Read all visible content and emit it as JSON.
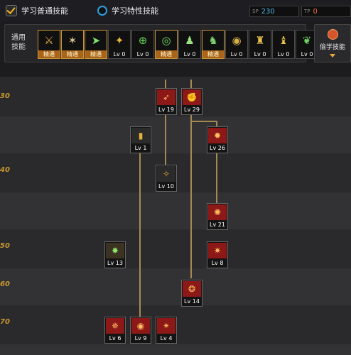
{
  "tabs": [
    {
      "label": "学习普通技能",
      "selected": true
    },
    {
      "label": "学习特性技能",
      "selected": false
    }
  ],
  "stats": [
    {
      "tag": "SP",
      "value": "230",
      "color": "#4fb8e8"
    },
    {
      "tag": "TP",
      "value": "0",
      "color": "#f06a3a"
    }
  ],
  "common_skills": {
    "label": "通用技能",
    "slots": [
      {
        "icon": "stance-icon",
        "glyph": "⚔",
        "color": "#e6b345",
        "level": "精通",
        "learned": true
      },
      {
        "icon": "leap-icon",
        "glyph": "✶",
        "color": "#d9c38a",
        "level": "精通",
        "learned": true
      },
      {
        "icon": "dash-icon",
        "glyph": "➤",
        "color": "#7ee36b",
        "level": "精通",
        "learned": true
      },
      {
        "icon": "wings-icon",
        "glyph": "✦",
        "color": "#e8b33a",
        "level": "Lv 0",
        "learned": false
      },
      {
        "icon": "crosshair-icon",
        "glyph": "⊕",
        "color": "#67d85a",
        "level": "Lv 0",
        "learned": false
      },
      {
        "icon": "target-icon",
        "glyph": "◎",
        "color": "#76de68",
        "level": "精通",
        "learned": true
      },
      {
        "icon": "fighter-icon",
        "glyph": "♟",
        "color": "#9ae07e",
        "level": "Lv 0",
        "learned": false
      },
      {
        "icon": "kick-icon",
        "glyph": "♞",
        "color": "#7bd36b",
        "level": "精通",
        "learned": true
      },
      {
        "icon": "shield-icon",
        "glyph": "◉",
        "color": "#d7b048",
        "level": "Lv 0",
        "learned": false
      },
      {
        "icon": "warrior-icon",
        "glyph": "♜",
        "color": "#e8c04c",
        "level": "Lv 0",
        "learned": false
      },
      {
        "icon": "power-icon",
        "glyph": "♝",
        "color": "#e8c54a",
        "level": "Lv 0",
        "learned": false
      },
      {
        "icon": "vine-icon",
        "glyph": "❦",
        "color": "#6fd35f",
        "level": "Lv 0",
        "learned": false
      }
    ]
  },
  "steal_skill": {
    "label": "偷学技能"
  },
  "level_markers": [
    "30",
    "40",
    "50",
    "60",
    "70"
  ],
  "tree_nodes": [
    {
      "name": "skill-node-lv19",
      "icon": "claw-slash-icon",
      "glyph": "➶",
      "style": "red",
      "level": "Lv 19"
    },
    {
      "name": "skill-node-lv29",
      "icon": "fist-icon",
      "glyph": "✊",
      "style": "red",
      "level": "Lv 29"
    },
    {
      "name": "skill-node-lv1",
      "icon": "bullet-icon",
      "glyph": "▮",
      "style": "gold",
      "level": "Lv 1"
    },
    {
      "name": "skill-node-lv26",
      "icon": "flame-icon",
      "glyph": "✹",
      "style": "red",
      "level": "Lv 26"
    },
    {
      "name": "skill-node-lv10",
      "icon": "gunshot-icon",
      "glyph": "✧",
      "style": "gold",
      "level": "Lv 10"
    },
    {
      "name": "skill-node-lv21",
      "icon": "kick-burst-icon",
      "glyph": "✺",
      "style": "red",
      "level": "Lv 21"
    },
    {
      "name": "skill-node-lv13",
      "icon": "explosion-icon",
      "glyph": "✸",
      "style": "green",
      "level": "Lv 13"
    },
    {
      "name": "skill-node-lv8",
      "icon": "blaze-icon",
      "glyph": "✷",
      "style": "red",
      "level": "Lv 8"
    },
    {
      "name": "skill-node-lv14",
      "icon": "beast-icon",
      "glyph": "❂",
      "style": "red",
      "level": "Lv 14"
    },
    {
      "name": "skill-node-lv6",
      "icon": "fire-slash-icon",
      "glyph": "✵",
      "style": "red",
      "level": "Lv 6"
    },
    {
      "name": "skill-node-lv9",
      "icon": "ring-icon",
      "glyph": "◉",
      "style": "red",
      "level": "Lv 9"
    },
    {
      "name": "skill-node-lv4",
      "icon": "claw-icon",
      "glyph": "✴",
      "style": "red",
      "level": "Lv 4"
    }
  ]
}
